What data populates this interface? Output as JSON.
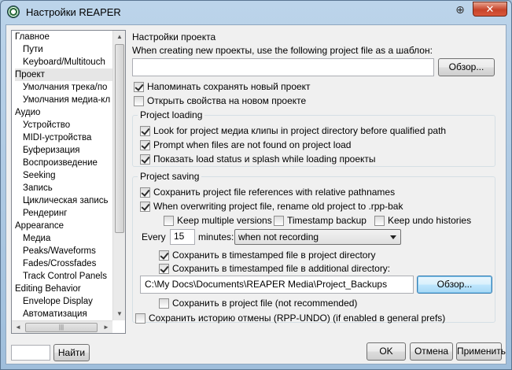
{
  "window": {
    "title": "Настройки REAPER",
    "pin_glyph": "⊕",
    "close_glyph": "✕"
  },
  "tree": {
    "items": [
      {
        "label": "Главное",
        "level": 0
      },
      {
        "label": "Пути",
        "level": 1
      },
      {
        "label": "Keyboard/Multitouch",
        "level": 1
      },
      {
        "label": "Проект",
        "level": 0,
        "selected": true
      },
      {
        "label": "Умолчания трека/по",
        "level": 1
      },
      {
        "label": "Умолчания медиа-кл",
        "level": 1
      },
      {
        "label": "Аудио",
        "level": 0
      },
      {
        "label": "Устройство",
        "level": 1
      },
      {
        "label": "MIDI-устройства",
        "level": 1
      },
      {
        "label": "Буферизация",
        "level": 1
      },
      {
        "label": "Воспроизведение",
        "level": 1
      },
      {
        "label": "Seeking",
        "level": 1
      },
      {
        "label": "Запись",
        "level": 1
      },
      {
        "label": "Циклическая запись",
        "level": 1
      },
      {
        "label": "Рендеринг",
        "level": 1
      },
      {
        "label": "Appearance",
        "level": 0
      },
      {
        "label": "Медиа",
        "level": 1
      },
      {
        "label": "Peaks/Waveforms",
        "level": 1
      },
      {
        "label": "Fades/Crossfades",
        "level": 1
      },
      {
        "label": "Track Control Panels",
        "level": 1
      },
      {
        "label": "Editing Behavior",
        "level": 0
      },
      {
        "label": "Envelope Display",
        "level": 1
      },
      {
        "label": "Автоматизация",
        "level": 1
      }
    ],
    "scroll_up": "▲",
    "scroll_down": "▼",
    "scroll_left": "◄",
    "scroll_right": "►",
    "hthumb_grip": "|||"
  },
  "project": {
    "section_title": "Настройки проекта",
    "template_label": "When creating new проекты, use the following project file as a шаблон:",
    "template_path": "",
    "browse_label": "Обзор...",
    "remind_save": {
      "label": "Напоминать сохранять новый проект",
      "checked": true
    },
    "open_props": {
      "label": "Открыть свойства на новом проекте",
      "checked": false
    }
  },
  "loading": {
    "group_title": "Project loading",
    "look_media": {
      "label": "Look for project медиа клипы in project directory before qualified path",
      "checked": true
    },
    "prompt_missing": {
      "label": "Prompt when files are not found on project load",
      "checked": true
    },
    "show_status": {
      "label": "Показать load status и splash while loading проекты",
      "checked": true
    }
  },
  "saving": {
    "group_title": "Project saving",
    "relative_paths": {
      "label": "Сохранить project file references with relative pathnames",
      "checked": true
    },
    "rename_bak": {
      "label": "When overwriting project file, rename old project to .rpp-bak",
      "checked": true
    },
    "keep_multiple": {
      "label": "Keep multiple versions",
      "checked": false
    },
    "timestamp_backup": {
      "label": "Timestamp backup",
      "checked": false
    },
    "keep_undo": {
      "label": "Keep undo histories",
      "checked": false
    },
    "every_label": "Every",
    "every_value": "15",
    "minutes_label": "minutes:",
    "autosave_mode": "when not recording",
    "save_in_project_dir": {
      "label": "Сохранить в timestamped file в project directory",
      "checked": true
    },
    "save_in_additional": {
      "label": "Сохранить в timestamped file в additional directory:",
      "checked": true
    },
    "backup_path": "C:\\My Docs\\Documents\\REAPER Media\\Project_Backups",
    "browse_label": "Обзор...",
    "save_in_project_file": {
      "label": "Сохранить в project file (not recommended)",
      "checked": false
    }
  },
  "undo_history": {
    "label": "Сохранить историю отмены (RPP-UNDO) (if enabled в general prefs)",
    "checked": false
  },
  "footer": {
    "search_value": "",
    "find_label": "Найти",
    "ok_label": "OK",
    "cancel_label": "Отмена",
    "apply_label": "Применить"
  }
}
